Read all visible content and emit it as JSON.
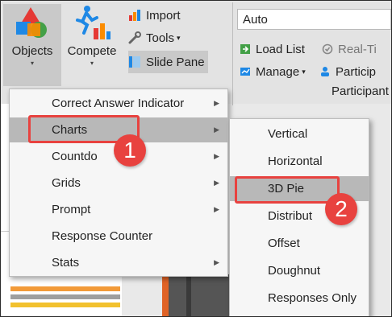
{
  "ribbon": {
    "objects_label": "Objects",
    "compete_label": "Compete",
    "import_label": "Import",
    "tools_label": "Tools",
    "slide_pane_label": "Slide Pane",
    "combo_value": "Auto",
    "load_list_label": "Load List",
    "real_time_label": "Real-Ti",
    "manage_label": "Manage",
    "participants_label": "Particip",
    "group_label": "Participant",
    "dropdown_caret": "▾",
    "small_caret": "▾"
  },
  "menu": {
    "items": [
      {
        "label": "Correct Answer Indicator",
        "arrow": "▶"
      },
      {
        "label": "Charts",
        "arrow": "▶"
      },
      {
        "label": "Countdo",
        "arrow": "▶"
      },
      {
        "label": "Grids",
        "arrow": "▶"
      },
      {
        "label": "Prompt",
        "arrow": "▶"
      },
      {
        "label": "Response Counter",
        "arrow": ""
      },
      {
        "label": "Stats",
        "arrow": "▶"
      }
    ]
  },
  "submenu": {
    "items": [
      {
        "label": "Vertical"
      },
      {
        "label": "Horizontal"
      },
      {
        "label": "3D Pie"
      },
      {
        "label": "Distribut"
      },
      {
        "label": "Offset"
      },
      {
        "label": "Doughnut"
      },
      {
        "label": "Responses Only"
      }
    ]
  },
  "callouts": {
    "step1": "1",
    "step2": "2"
  },
  "colors": {
    "highlight": "#e8423f",
    "active_row": "#b8b8b8",
    "menu_bg": "#f6f6f6"
  }
}
